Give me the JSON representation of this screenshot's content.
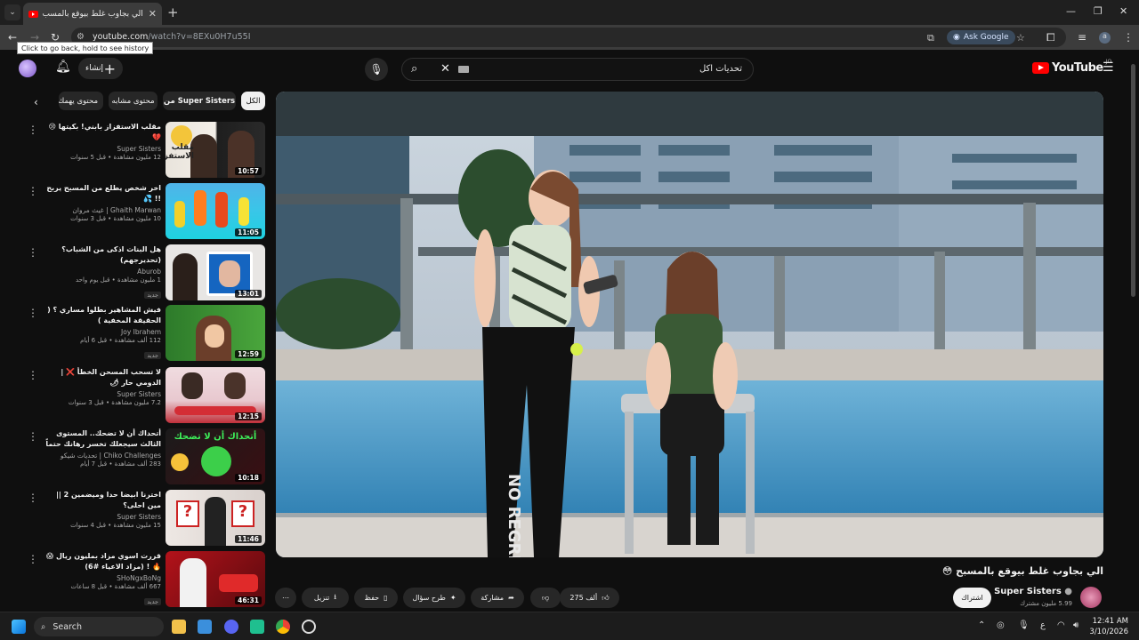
{
  "browser": {
    "tab_title": "الي بجاوب غلط بيوقع بالمسب",
    "url_domain": "youtube.com",
    "url_path": "/watch?v=8EXu0H7u55I",
    "tooltip": "Click to go back, hold to see history",
    "ask_google": "Ask Google",
    "profile_initial": "a"
  },
  "masthead": {
    "create_label": "إنشاء",
    "search_query": "تحديات اكل",
    "logo_text": "YouTube",
    "logo_country": "JO"
  },
  "chips": [
    "الكل",
    "من Super Sisters",
    "محتوى مشابه",
    "محتوى يهمك"
  ],
  "recommendations": [
    {
      "title": "مقلب الاستفزاز بابني! بكيتها 😢💔",
      "channel": "Super Sisters",
      "stats": "12 مليون مشاهدة • قبل 5 سنوات",
      "duration": "10:57",
      "new": ""
    },
    {
      "title": "اخر شخص يطلع من المسبح يربح !! 💦",
      "channel": "Ghaith Marwan | غيث مروان",
      "stats": "10 مليون مشاهدة • قبل 3 سنوات",
      "duration": "11:05",
      "new": ""
    },
    {
      "title": "هل البنات اذكى من الشباب؟ (تحديرجهم)",
      "channel": "Aburob",
      "stats": "1 مليون مشاهدة • قبل يوم واحد",
      "duration": "13:01",
      "new": "جديد"
    },
    {
      "title": "فيش المشاهير بطلوا مساري ؟ ( الحقيقة المخفية )",
      "channel": "Joy Ibrahem",
      "stats": "112 ألف مشاهدة • قبل 6 أيام",
      "duration": "12:59",
      "new": "جديد"
    },
    {
      "title": "لا تسحب المسحن الخطأ ❌ | الدومي حار 🌶",
      "channel": "Super Sisters",
      "stats": "7.2 مليون مشاهدة • قبل 3 سنوات",
      "duration": "12:15",
      "new": ""
    },
    {
      "title": "أتحداك أن لا تضحك.. المستوى الثالث سيجعلك تخسر رهانك حتماً 😈🔥",
      "channel": "Chiko Challenges | تحديات شيكو",
      "stats": "283 ألف مشاهدة • قبل 7 أيام",
      "duration": "10:18",
      "new": ""
    },
    {
      "title": "اخترنا ابيضا حدا وميضمين 2 || مين احلى؟",
      "channel": "Super Sisters",
      "stats": "15 مليون مشاهدة • قبل 4 سنوات",
      "duration": "11:46",
      "new": ""
    },
    {
      "title": "قررت اسوي مزاد بمليون ريال 😱🔥 ! (مزاد الاعياء #6)",
      "channel": "SHoNgxBoNg",
      "stats": "667 ألف مشاهدة • قبل 8 ساعات",
      "duration": "46:31",
      "new": "جديد"
    }
  ],
  "thumbnail_texts": [
    "مقلب الاستفزاز",
    "أتحداك أن لا تضحك"
  ],
  "video": {
    "title": "الي بجاوب غلط بيوقع بالمسبح 😳",
    "channel": "Super Sisters",
    "subscribers": "5.99 مليون مشترك",
    "subscribe": "اشتراك",
    "likes": "275 ألف",
    "share": "مشاركة",
    "ask": "طرح سؤال",
    "save": "حفظ",
    "download": "تنزيل",
    "pants_text": "NO REGRET"
  },
  "taskbar": {
    "search": "Search",
    "lang": "ع",
    "time": "12:41 AM",
    "date": "3/10/2026"
  },
  "colors": {
    "yt_red": "#ff0000",
    "bg": "#0f0f0f",
    "chip_bg": "#272727"
  }
}
